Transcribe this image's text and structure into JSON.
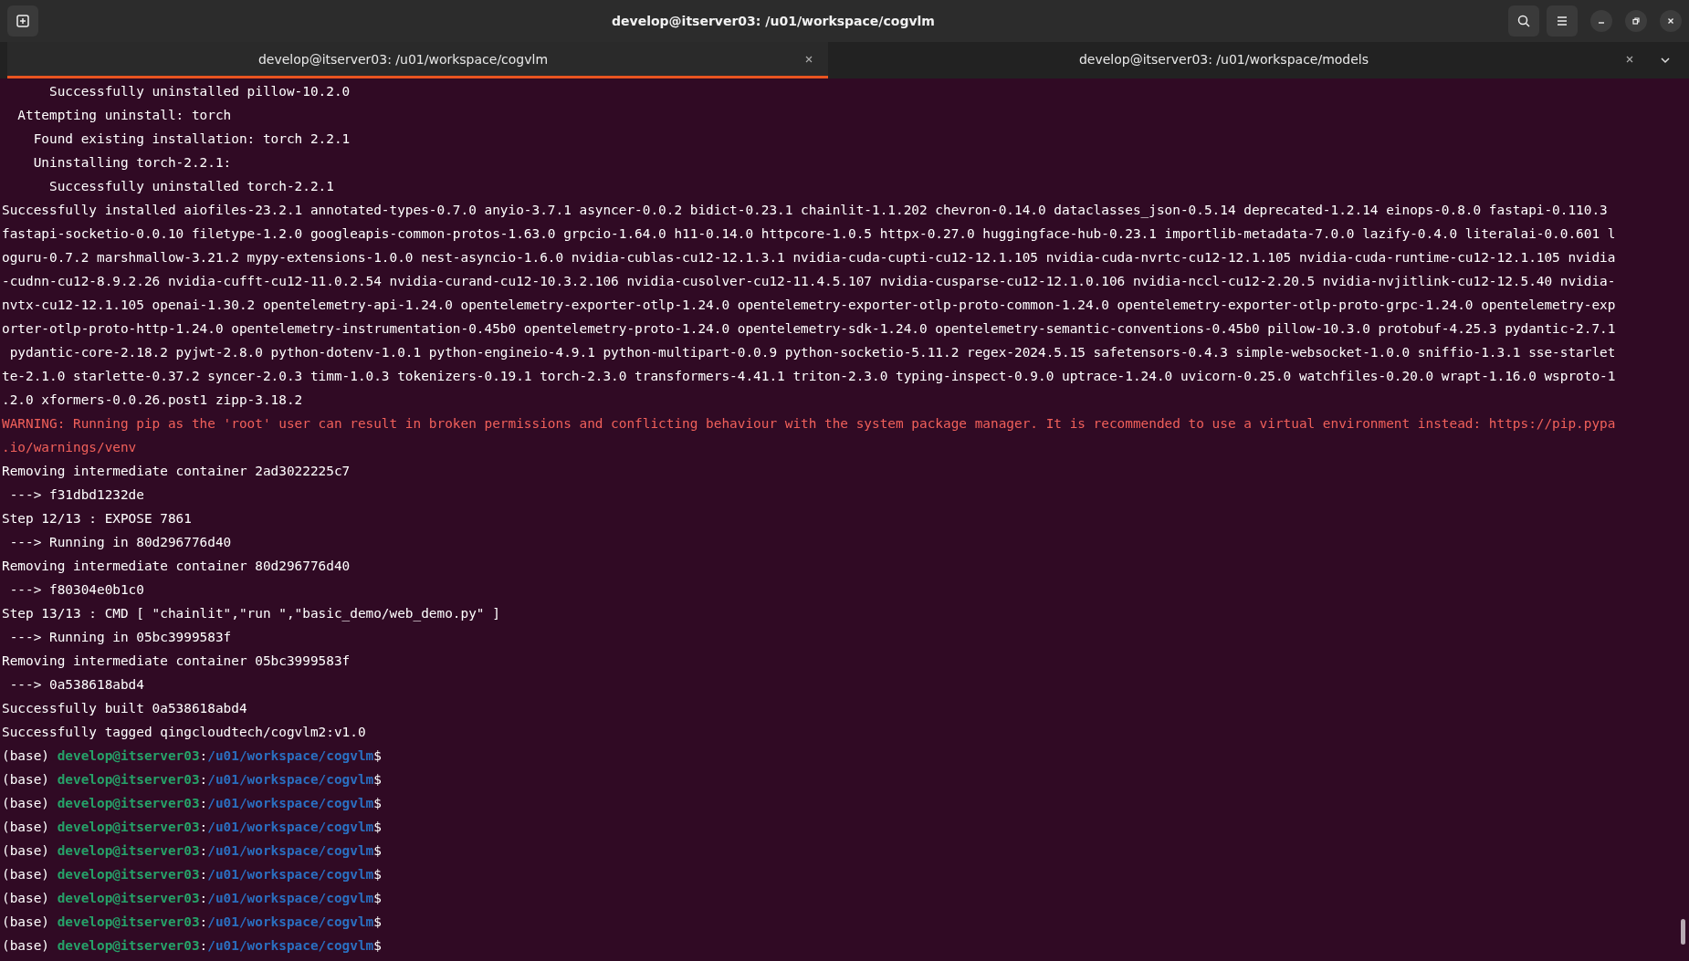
{
  "window": {
    "title": "develop@itserver03: /u01/workspace/cogvlm"
  },
  "tabs": [
    {
      "label": "develop@itserver03: /u01/workspace/cogvlm",
      "selected": true
    },
    {
      "label": "develop@itserver03: /u01/workspace/models",
      "selected": false
    }
  ],
  "terminal": {
    "lines": [
      {
        "kind": "plain",
        "text": "      Successfully uninstalled pillow-10.2.0"
      },
      {
        "kind": "plain",
        "text": "  Attempting uninstall: torch"
      },
      {
        "kind": "plain",
        "text": "    Found existing installation: torch 2.2.1"
      },
      {
        "kind": "plain",
        "text": "    Uninstalling torch-2.2.1:"
      },
      {
        "kind": "plain",
        "text": "      Successfully uninstalled torch-2.2.1"
      },
      {
        "kind": "plain",
        "text": "Successfully installed aiofiles-23.2.1 annotated-types-0.7.0 anyio-3.7.1 asyncer-0.0.2 bidict-0.23.1 chainlit-1.1.202 chevron-0.14.0 dataclasses_json-0.5.14 deprecated-1.2.14 einops-0.8.0 fastapi-0.110.3"
      },
      {
        "kind": "plain",
        "text": "fastapi-socketio-0.0.10 filetype-1.2.0 googleapis-common-protos-1.63.0 grpcio-1.64.0 h11-0.14.0 httpcore-1.0.5 httpx-0.27.0 huggingface-hub-0.23.1 importlib-metadata-7.0.0 lazify-0.4.0 literalai-0.0.601 l"
      },
      {
        "kind": "plain",
        "text": "oguru-0.7.2 marshmallow-3.21.2 mypy-extensions-1.0.0 nest-asyncio-1.6.0 nvidia-cublas-cu12-12.1.3.1 nvidia-cuda-cupti-cu12-12.1.105 nvidia-cuda-nvrtc-cu12-12.1.105 nvidia-cuda-runtime-cu12-12.1.105 nvidia"
      },
      {
        "kind": "plain",
        "text": "-cudnn-cu12-8.9.2.26 nvidia-cufft-cu12-11.0.2.54 nvidia-curand-cu12-10.3.2.106 nvidia-cusolver-cu12-11.4.5.107 nvidia-cusparse-cu12-12.1.0.106 nvidia-nccl-cu12-2.20.5 nvidia-nvjitlink-cu12-12.5.40 nvidia-"
      },
      {
        "kind": "plain",
        "text": "nvtx-cu12-12.1.105 openai-1.30.2 opentelemetry-api-1.24.0 opentelemetry-exporter-otlp-1.24.0 opentelemetry-exporter-otlp-proto-common-1.24.0 opentelemetry-exporter-otlp-proto-grpc-1.24.0 opentelemetry-exp"
      },
      {
        "kind": "plain",
        "text": "orter-otlp-proto-http-1.24.0 opentelemetry-instrumentation-0.45b0 opentelemetry-proto-1.24.0 opentelemetry-sdk-1.24.0 opentelemetry-semantic-conventions-0.45b0 pillow-10.3.0 protobuf-4.25.3 pydantic-2.7.1"
      },
      {
        "kind": "plain",
        "text": " pydantic-core-2.18.2 pyjwt-2.8.0 python-dotenv-1.0.1 python-engineio-4.9.1 python-multipart-0.0.9 python-socketio-5.11.2 regex-2024.5.15 safetensors-0.4.3 simple-websocket-1.0.0 sniffio-1.3.1 sse-starlet"
      },
      {
        "kind": "plain",
        "text": "te-2.1.0 starlette-0.37.2 syncer-2.0.3 timm-1.0.3 tokenizers-0.19.1 torch-2.3.0 transformers-4.41.1 triton-2.3.0 typing-inspect-0.9.0 uptrace-1.24.0 uvicorn-0.25.0 watchfiles-0.20.0 wrapt-1.16.0 wsproto-1"
      },
      {
        "kind": "plain",
        "text": ".2.0 xformers-0.0.26.post1 zipp-3.18.2"
      },
      {
        "kind": "warning",
        "text": "WARNING: Running pip as the 'root' user can result in broken permissions and conflicting behaviour with the system package manager. It is recommended to use a virtual environment instead: https://pip.pypa"
      },
      {
        "kind": "warning",
        "text": ".io/warnings/venv"
      },
      {
        "kind": "plain",
        "text": "Removing intermediate container 2ad3022225c7"
      },
      {
        "kind": "plain",
        "text": " ---> f31dbd1232de"
      },
      {
        "kind": "plain",
        "text": "Step 12/13 : EXPOSE 7861"
      },
      {
        "kind": "plain",
        "text": " ---> Running in 80d296776d40"
      },
      {
        "kind": "plain",
        "text": "Removing intermediate container 80d296776d40"
      },
      {
        "kind": "plain",
        "text": " ---> f80304e0b1c0"
      },
      {
        "kind": "plain",
        "text": "Step 13/13 : CMD [ \"chainlit\",\"run \",\"basic_demo/web_demo.py\" ]"
      },
      {
        "kind": "plain",
        "text": " ---> Running in 05bc3999583f"
      },
      {
        "kind": "plain",
        "text": "Removing intermediate container 05bc3999583f"
      },
      {
        "kind": "plain",
        "text": " ---> 0a538618abd4"
      },
      {
        "kind": "plain",
        "text": "Successfully built 0a538618abd4"
      },
      {
        "kind": "plain",
        "text": "Successfully tagged qingcloudtech/cogvlm2:v1.0"
      },
      {
        "kind": "prompt",
        "env": "(base)",
        "user": "develop@itserver03",
        "sep": ":",
        "path": "/u01/workspace/cogvlm",
        "sign": "$"
      },
      {
        "kind": "prompt",
        "env": "(base)",
        "user": "develop@itserver03",
        "sep": ":",
        "path": "/u01/workspace/cogvlm",
        "sign": "$"
      },
      {
        "kind": "prompt",
        "env": "(base)",
        "user": "develop@itserver03",
        "sep": ":",
        "path": "/u01/workspace/cogvlm",
        "sign": "$"
      },
      {
        "kind": "prompt",
        "env": "(base)",
        "user": "develop@itserver03",
        "sep": ":",
        "path": "/u01/workspace/cogvlm",
        "sign": "$"
      },
      {
        "kind": "prompt",
        "env": "(base)",
        "user": "develop@itserver03",
        "sep": ":",
        "path": "/u01/workspace/cogvlm",
        "sign": "$"
      },
      {
        "kind": "prompt",
        "env": "(base)",
        "user": "develop@itserver03",
        "sep": ":",
        "path": "/u01/workspace/cogvlm",
        "sign": "$"
      },
      {
        "kind": "prompt",
        "env": "(base)",
        "user": "develop@itserver03",
        "sep": ":",
        "path": "/u01/workspace/cogvlm",
        "sign": "$"
      },
      {
        "kind": "prompt",
        "env": "(base)",
        "user": "develop@itserver03",
        "sep": ":",
        "path": "/u01/workspace/cogvlm",
        "sign": "$"
      },
      {
        "kind": "prompt",
        "env": "(base)",
        "user": "develop@itserver03",
        "sep": ":",
        "path": "/u01/workspace/cogvlm",
        "sign": "$"
      }
    ]
  }
}
